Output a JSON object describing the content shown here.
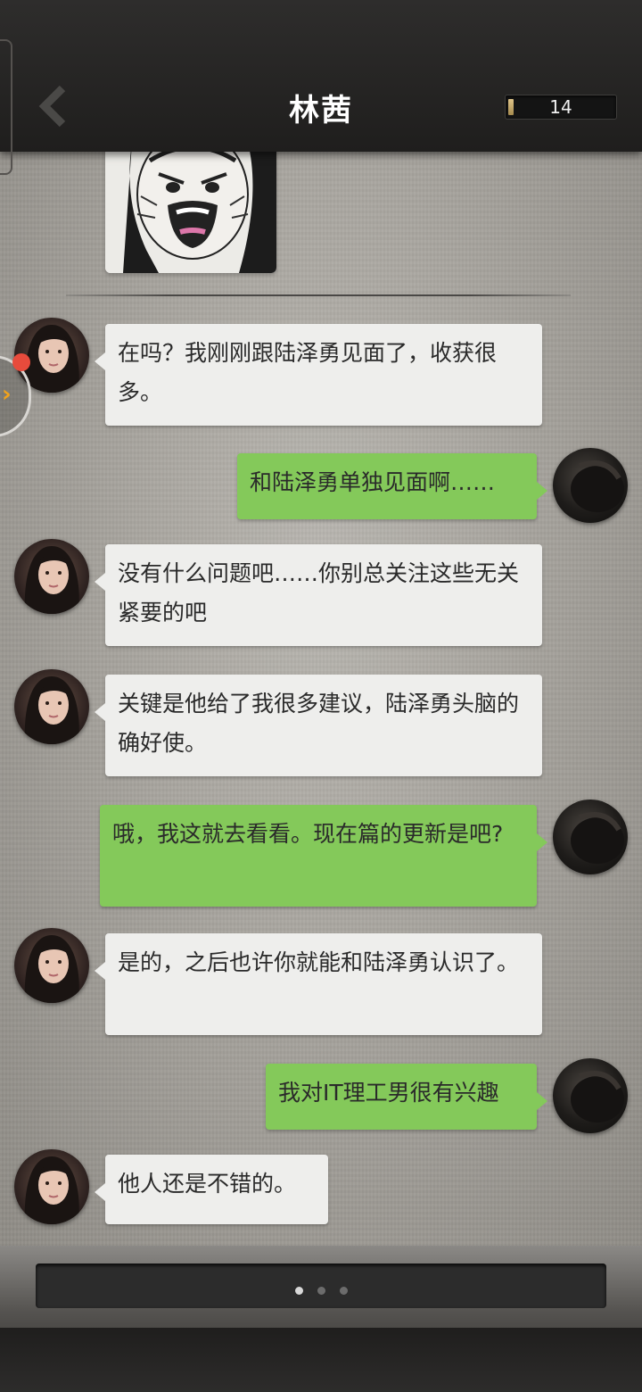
{
  "header": {
    "title": "林茜",
    "counter": "14"
  },
  "messages": [
    {
      "side": "left",
      "text": "在吗？我刚刚跟陆泽勇见面了，收获很多。"
    },
    {
      "side": "right",
      "text": "和陆泽勇单独见面啊……"
    },
    {
      "side": "left",
      "text": "没有什么问题吧……你别总关注这些无关紧要的吧"
    },
    {
      "side": "left",
      "text": "关键是他给了我很多建议，陆泽勇头脑的确好使。"
    },
    {
      "side": "right",
      "text": "哦，我这就去看看。现在篇的更新是吧?"
    },
    {
      "side": "left",
      "text": "是的，之后也许你就能和陆泽勇认识了。"
    },
    {
      "side": "right",
      "text": "我对IT理工男很有兴趣"
    },
    {
      "side": "left",
      "text": "他人还是不错的。"
    }
  ],
  "footer": {
    "page_dots": 3,
    "active_dot": 1
  },
  "colors": {
    "bubble_incoming": "#eeeeec",
    "bubble_outgoing": "#84c95a",
    "header": "#262524",
    "notify": "#e84b3c",
    "accent": "#f2a31b"
  }
}
